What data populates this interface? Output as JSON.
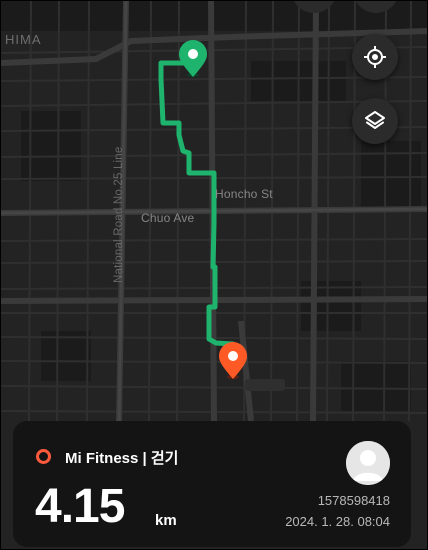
{
  "map": {
    "labels": {
      "area": "HIMA",
      "national_road": "National Road No.25 Line",
      "honcho": "Honcho St",
      "chuo": "Chuo Ave"
    },
    "route_color": "#1fb46d",
    "start_pin_color": "#1fb46d",
    "end_pin_color": "#ff5a26"
  },
  "controls": {
    "locate_icon": "locate-crosshair-icon",
    "layers_icon": "layers-icon"
  },
  "card": {
    "app_name": "Mi Fitness | 걷기",
    "distance": "4.15",
    "unit": "km",
    "user_id": "1578598418",
    "timestamp": "2024. 1. 28. 08:04",
    "accent_color": "#ff5a3c"
  }
}
